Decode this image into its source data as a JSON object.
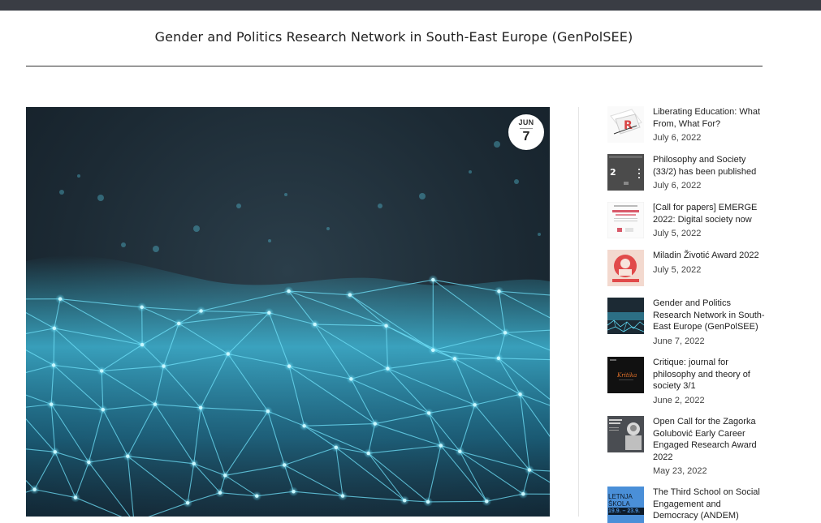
{
  "header": {
    "title": "Gender and Politics Research Network in South-East Europe (GenPolSEE)"
  },
  "post": {
    "date_month": "JUN",
    "date_day": "7",
    "image_icon": "network-mesh-image"
  },
  "sidebar": {
    "items": [
      {
        "title": "Liberating Education: What From, What For?",
        "date": "July 6, 2022",
        "thumb_icon": "book-cover-thumbnail"
      },
      {
        "title": "Philosophy and Society (33/2) has been published",
        "date": "July 6, 2022",
        "thumb_icon": "journal-cover-thumbnail"
      },
      {
        "title": "[Call for papers] EMERGE 2022: Digital society now",
        "date": "July 5, 2022",
        "thumb_icon": "conference-poster-thumbnail"
      },
      {
        "title": "Miladin Životić Award 2022",
        "date": "July 5, 2022",
        "thumb_icon": "award-poster-thumbnail"
      },
      {
        "title": "Gender and Politics Research Network in South-East Europe (GenPolSEE)",
        "date": "June 7, 2022",
        "thumb_icon": "network-mesh-thumbnail"
      },
      {
        "title": "Critique: journal for philosophy and theory of society 3/1",
        "date": "June 2, 2022",
        "thumb_icon": "critique-cover-thumbnail"
      },
      {
        "title": "Open Call for the Zagorka Golubović Early Career Engaged Research Award 2022",
        "date": "May 23, 2022",
        "thumb_icon": "portrait-poster-thumbnail"
      },
      {
        "title": "The Third School on Social Engagement and Democracy (ANDEM)",
        "date": "",
        "thumb_icon": "school-poster-thumbnail",
        "thumb_text_1": "LETNJA",
        "thumb_text_2": "ŠKOLA",
        "thumb_text_3": "19.9. – 23.9."
      }
    ]
  },
  "colors": {
    "topbar": "#3a3d44",
    "accent_cyan": "#3fd0f0"
  }
}
